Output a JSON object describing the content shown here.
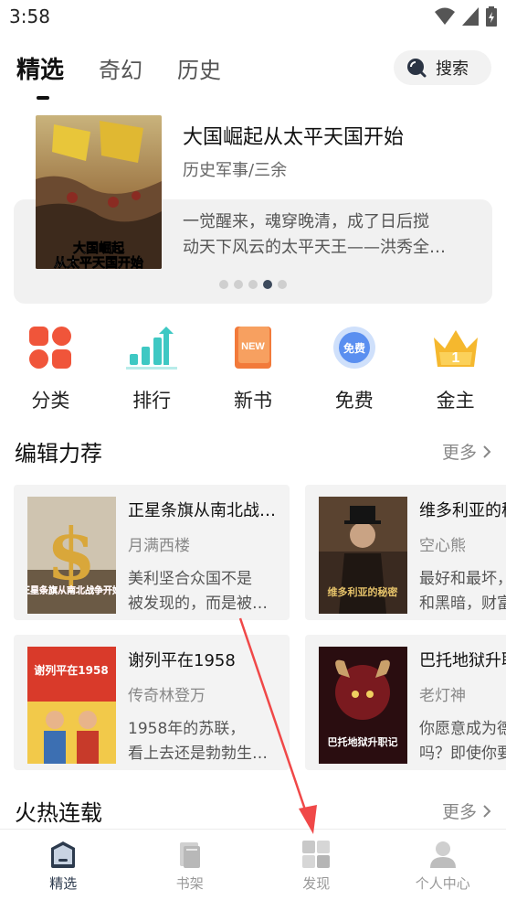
{
  "status_bar": {
    "time": "3:58"
  },
  "tabs": [
    {
      "label": "精选",
      "active": true
    },
    {
      "label": "奇幻",
      "active": false
    },
    {
      "label": "历史",
      "active": false
    }
  ],
  "search": {
    "label": "搜索",
    "icon": "search-icon"
  },
  "banner": {
    "title": "大国崛起从太平天国开始",
    "subtitle": "历史军事/三余",
    "desc_line1": "一觉醒来，魂穿晚清，成了日后搅",
    "desc_line2": "动天下风云的太平天王——洪秀全…",
    "cover_text_line1": "大国崛起",
    "cover_text_line2": "从太平天国开始",
    "page_count": 5,
    "active_page": 4
  },
  "categories": [
    {
      "label": "分类",
      "icon": "category-icon"
    },
    {
      "label": "排行",
      "icon": "ranking-icon"
    },
    {
      "label": "新书",
      "icon": "new-book-icon",
      "badge": "NEW"
    },
    {
      "label": "免费",
      "icon": "free-icon",
      "badge": "免费"
    },
    {
      "label": "金主",
      "icon": "crown-icon",
      "badge": "1"
    }
  ],
  "editor_picks": {
    "title": "编辑力荐",
    "more": "更多",
    "books": [
      {
        "title": "正星条旗从南北战…",
        "author": "月满西楼",
        "desc_line1": "美利坚合众国不是",
        "desc_line2": "被发现的，而是被…",
        "cover_text": "正星条旗从南北战争开始"
      },
      {
        "title": "维多利亚的秘密",
        "author": "空心熊",
        "desc_line1": "最好和最坏，",
        "desc_line2": "和黑暗，财富",
        "cover_text": "维多利亚的秘密"
      },
      {
        "title": "谢列平在1958",
        "author": "传奇林登万",
        "desc_line1": "1958年的苏联，",
        "desc_line2": "看上去还是勃勃生…",
        "cover_text": "谢列平在1958"
      },
      {
        "title": "巴托地狱升职记",
        "author": "老灯神",
        "desc_line1": "你愿意成为德",
        "desc_line2": "吗？即使你要",
        "cover_text": "巴托地狱升职记"
      }
    ]
  },
  "serial": {
    "title": "火热连载",
    "more": "更多"
  },
  "bottom_nav": [
    {
      "label": "精选",
      "icon": "home-icon",
      "active": true
    },
    {
      "label": "书架",
      "icon": "bookshelf-icon",
      "active": false
    },
    {
      "label": "发现",
      "icon": "discover-icon",
      "active": false
    },
    {
      "label": "个人中心",
      "icon": "profile-icon",
      "active": false
    }
  ],
  "colors": {
    "accent_dark": "#2c3a4d",
    "category_red": "#f0553a",
    "ranking_teal": "#3ec8c3",
    "new_orange": "#f27a3a",
    "free_blue": "#5a8ff0",
    "crown_gold": "#f5b82e",
    "annotation_arrow": "#f04848"
  }
}
